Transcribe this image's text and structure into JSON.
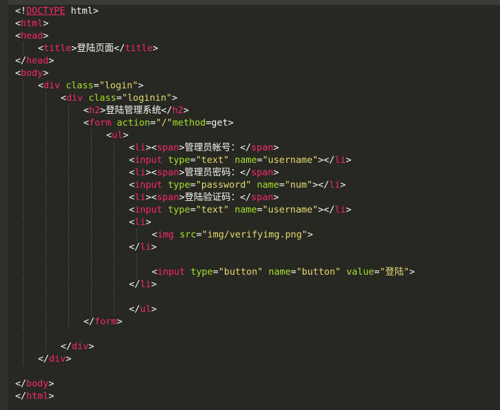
{
  "editor": {
    "language": "html",
    "colors": {
      "background": "#272822",
      "gutter": "#2f302a",
      "text": "#f8f8f2",
      "tag": "#f92672",
      "attribute": "#a6e22e",
      "string": "#e6db74",
      "indent_guide": "#55564f"
    },
    "lines": [
      {
        "indent": 0,
        "guides": 0,
        "tokens": [
          [
            "punct",
            "<!"
          ],
          [
            "kw",
            "DOCTYPE"
          ],
          [
            "sp",
            " "
          ],
          [
            "text",
            "html"
          ],
          [
            "punct",
            ">"
          ]
        ]
      },
      {
        "indent": 0,
        "guides": 0,
        "tokens": [
          [
            "punct",
            "<"
          ],
          [
            "tag",
            "html"
          ],
          [
            "punct",
            ">"
          ]
        ]
      },
      {
        "indent": 0,
        "guides": 0,
        "tokens": [
          [
            "punct",
            "<"
          ],
          [
            "tag",
            "head"
          ],
          [
            "punct",
            ">"
          ]
        ]
      },
      {
        "indent": 1,
        "guides": 1,
        "tokens": [
          [
            "punct",
            "<"
          ],
          [
            "tag",
            "title"
          ],
          [
            "punct",
            ">"
          ],
          [
            "text",
            "登陆页面"
          ],
          [
            "punct",
            "</"
          ],
          [
            "tag",
            "title"
          ],
          [
            "punct",
            ">"
          ]
        ]
      },
      {
        "indent": 0,
        "guides": 0,
        "tokens": [
          [
            "punct",
            "</"
          ],
          [
            "tag",
            "head"
          ],
          [
            "punct",
            ">"
          ]
        ]
      },
      {
        "indent": 0,
        "guides": 0,
        "tokens": [
          [
            "punct",
            "<"
          ],
          [
            "tag",
            "body"
          ],
          [
            "punct",
            ">"
          ]
        ]
      },
      {
        "indent": 1,
        "guides": 1,
        "tokens": [
          [
            "punct",
            "<"
          ],
          [
            "tag",
            "div"
          ],
          [
            "sp",
            " "
          ],
          [
            "attr",
            "class"
          ],
          [
            "punct",
            "="
          ],
          [
            "str",
            "\"login\""
          ],
          [
            "punct",
            ">"
          ]
        ]
      },
      {
        "indent": 2,
        "guides": 2,
        "tokens": [
          [
            "punct",
            "<"
          ],
          [
            "tag",
            "div"
          ],
          [
            "sp",
            " "
          ],
          [
            "attr",
            "class"
          ],
          [
            "punct",
            "="
          ],
          [
            "str",
            "\"loginin\""
          ],
          [
            "punct",
            ">"
          ]
        ]
      },
      {
        "indent": 3,
        "guides": 3,
        "tokens": [
          [
            "punct",
            "<"
          ],
          [
            "tag",
            "h2"
          ],
          [
            "punct",
            ">"
          ],
          [
            "text",
            "登陆管理系统"
          ],
          [
            "punct",
            "</"
          ],
          [
            "tag",
            "h2"
          ],
          [
            "punct",
            ">"
          ]
        ]
      },
      {
        "indent": 3,
        "guides": 3,
        "tokens": [
          [
            "punct",
            "<"
          ],
          [
            "tag",
            "form"
          ],
          [
            "sp",
            " "
          ],
          [
            "attr",
            "action"
          ],
          [
            "punct",
            "="
          ],
          [
            "str",
            "\"/\""
          ],
          [
            "attr",
            "method"
          ],
          [
            "punct",
            "=get>"
          ]
        ]
      },
      {
        "indent": 4,
        "guides": 4,
        "tokens": [
          [
            "punct",
            "<"
          ],
          [
            "tag",
            "ul"
          ],
          [
            "punct",
            ">"
          ]
        ]
      },
      {
        "indent": 5,
        "guides": 5,
        "tokens": [
          [
            "punct",
            "<"
          ],
          [
            "tag",
            "li"
          ],
          [
            "punct",
            "><"
          ],
          [
            "tag",
            "span"
          ],
          [
            "punct",
            ">"
          ],
          [
            "text",
            "管理员帐号："
          ],
          [
            "punct",
            "</"
          ],
          [
            "tag",
            "span"
          ],
          [
            "punct",
            ">"
          ]
        ]
      },
      {
        "indent": 5,
        "guides": 5,
        "tokens": [
          [
            "punct",
            "<"
          ],
          [
            "tag",
            "input"
          ],
          [
            "sp",
            " "
          ],
          [
            "attr",
            "type"
          ],
          [
            "punct",
            "="
          ],
          [
            "str",
            "\"text\""
          ],
          [
            "sp",
            " "
          ],
          [
            "attr",
            "name"
          ],
          [
            "punct",
            "="
          ],
          [
            "str",
            "\"username\""
          ],
          [
            "punct",
            "></"
          ],
          [
            "tag",
            "li"
          ],
          [
            "punct",
            ">"
          ]
        ]
      },
      {
        "indent": 5,
        "guides": 5,
        "tokens": [
          [
            "punct",
            "<"
          ],
          [
            "tag",
            "li"
          ],
          [
            "punct",
            "><"
          ],
          [
            "tag",
            "span"
          ],
          [
            "punct",
            ">"
          ],
          [
            "text",
            "管理员密码："
          ],
          [
            "punct",
            "</"
          ],
          [
            "tag",
            "span"
          ],
          [
            "punct",
            ">"
          ]
        ]
      },
      {
        "indent": 5,
        "guides": 5,
        "tokens": [
          [
            "punct",
            "<"
          ],
          [
            "tag",
            "input"
          ],
          [
            "sp",
            " "
          ],
          [
            "attr",
            "type"
          ],
          [
            "punct",
            "="
          ],
          [
            "str",
            "\"password\""
          ],
          [
            "sp",
            " "
          ],
          [
            "attr",
            "name"
          ],
          [
            "punct",
            "="
          ],
          [
            "str",
            "\"num\""
          ],
          [
            "punct",
            "></"
          ],
          [
            "tag",
            "li"
          ],
          [
            "punct",
            ">"
          ]
        ]
      },
      {
        "indent": 5,
        "guides": 5,
        "tokens": [
          [
            "punct",
            "<"
          ],
          [
            "tag",
            "li"
          ],
          [
            "punct",
            "><"
          ],
          [
            "tag",
            "span"
          ],
          [
            "punct",
            ">"
          ],
          [
            "text",
            "登陆验证码："
          ],
          [
            "punct",
            "</"
          ],
          [
            "tag",
            "span"
          ],
          [
            "punct",
            ">"
          ]
        ]
      },
      {
        "indent": 5,
        "guides": 5,
        "tokens": [
          [
            "punct",
            "<"
          ],
          [
            "tag",
            "input"
          ],
          [
            "sp",
            " "
          ],
          [
            "attr",
            "type"
          ],
          [
            "punct",
            "="
          ],
          [
            "str",
            "\"text\""
          ],
          [
            "sp",
            " "
          ],
          [
            "attr",
            "name"
          ],
          [
            "punct",
            "="
          ],
          [
            "str",
            "\"username\""
          ],
          [
            "punct",
            "></"
          ],
          [
            "tag",
            "li"
          ],
          [
            "punct",
            ">"
          ]
        ]
      },
      {
        "indent": 5,
        "guides": 5,
        "tokens": [
          [
            "punct",
            "<"
          ],
          [
            "tag",
            "li"
          ],
          [
            "punct",
            ">"
          ]
        ]
      },
      {
        "indent": 6,
        "guides": 6,
        "tokens": [
          [
            "punct",
            "<"
          ],
          [
            "tag",
            "img"
          ],
          [
            "sp",
            " "
          ],
          [
            "attr",
            "src"
          ],
          [
            "punct",
            "="
          ],
          [
            "str",
            "\"img/verifyimg.png\""
          ],
          [
            "punct",
            ">"
          ]
        ]
      },
      {
        "indent": 5,
        "guides": 5,
        "tokens": [
          [
            "punct",
            "</"
          ],
          [
            "tag",
            "li"
          ],
          [
            "punct",
            ">"
          ]
        ]
      },
      {
        "indent": 5,
        "guides": 6,
        "tokens": []
      },
      {
        "indent": 6,
        "guides": 6,
        "tokens": [
          [
            "punct",
            "<"
          ],
          [
            "tag",
            "input"
          ],
          [
            "sp",
            " "
          ],
          [
            "attr",
            "type"
          ],
          [
            "punct",
            "="
          ],
          [
            "str",
            "\"button\""
          ],
          [
            "sp",
            " "
          ],
          [
            "attr",
            "name"
          ],
          [
            "punct",
            "="
          ],
          [
            "str",
            "\"button\""
          ],
          [
            "sp",
            " "
          ],
          [
            "attr",
            "value"
          ],
          [
            "punct",
            "="
          ],
          [
            "str",
            "\"登陆\""
          ],
          [
            "punct",
            ">"
          ]
        ]
      },
      {
        "indent": 5,
        "guides": 5,
        "tokens": [
          [
            "punct",
            "</"
          ],
          [
            "tag",
            "li"
          ],
          [
            "punct",
            ">"
          ]
        ]
      },
      {
        "indent": 5,
        "guides": 5,
        "tokens": []
      },
      {
        "indent": 5,
        "guides": 5,
        "tokens": [
          [
            "punct",
            "</"
          ],
          [
            "tag",
            "ul"
          ],
          [
            "punct",
            ">"
          ]
        ]
      },
      {
        "indent": 3,
        "guides": 3,
        "tokens": [
          [
            "punct",
            "</"
          ],
          [
            "tag",
            "form"
          ],
          [
            "punct",
            ">"
          ]
        ]
      },
      {
        "indent": 2,
        "guides": 2,
        "tokens": []
      },
      {
        "indent": 2,
        "guides": 2,
        "tokens": [
          [
            "punct",
            "</"
          ],
          [
            "tag",
            "div"
          ],
          [
            "punct",
            ">"
          ]
        ]
      },
      {
        "indent": 1,
        "guides": 1,
        "tokens": [
          [
            "punct",
            "</"
          ],
          [
            "tag",
            "div"
          ],
          [
            "punct",
            ">"
          ]
        ]
      },
      {
        "indent": 0,
        "guides": 0,
        "tokens": []
      },
      {
        "indent": 0,
        "guides": 0,
        "tokens": [
          [
            "punct",
            "</"
          ],
          [
            "tag",
            "body"
          ],
          [
            "punct",
            ">"
          ]
        ]
      },
      {
        "indent": 0,
        "guides": 0,
        "tokens": [
          [
            "punct",
            "</"
          ],
          [
            "tag",
            "html"
          ],
          [
            "punct",
            ">"
          ]
        ]
      }
    ]
  }
}
